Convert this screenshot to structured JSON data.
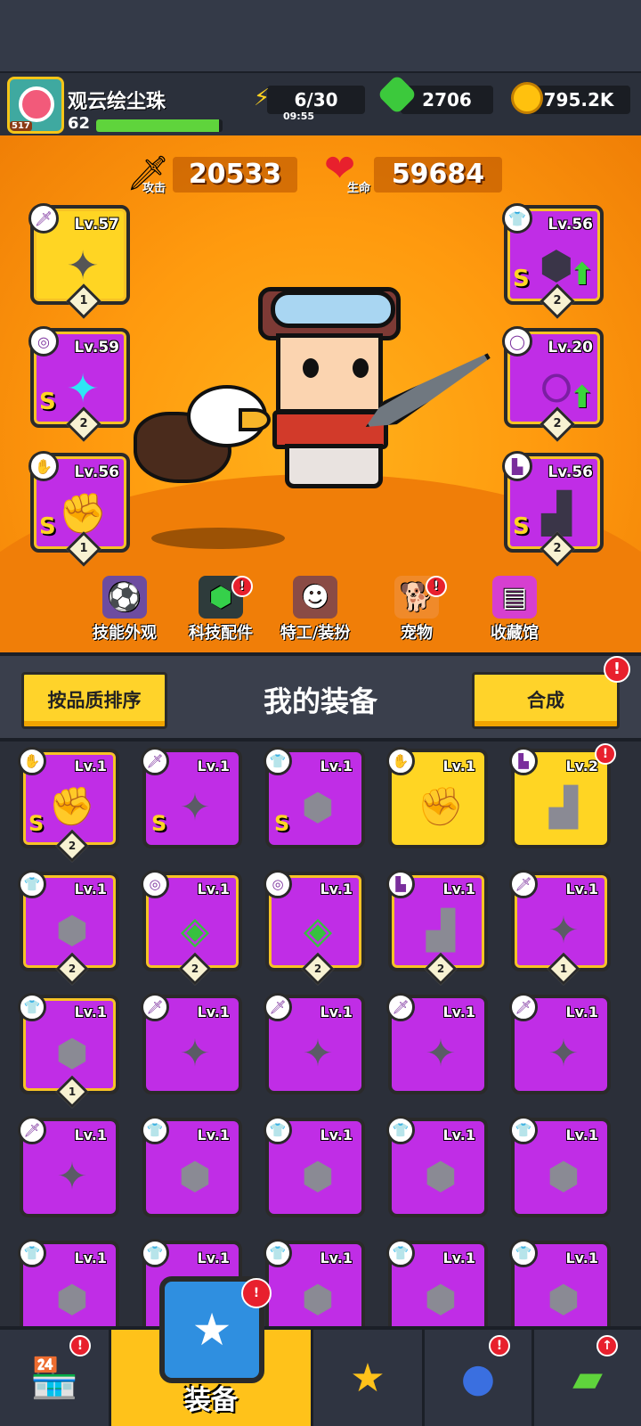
{
  "player": {
    "name": "观云绘尘珠",
    "level": "62",
    "badge": "517",
    "xp_fraction": 0.97
  },
  "resources": {
    "energy": {
      "value": "6/30",
      "timer": "09:55"
    },
    "gems": {
      "value": "2706"
    },
    "coins": {
      "value": "795.2K"
    }
  },
  "stats": {
    "attack": {
      "label": "攻击",
      "value": "20533"
    },
    "hp": {
      "label": "生命",
      "value": "59684"
    }
  },
  "equipped": [
    {
      "slot": "weapon",
      "level": "Lv.57",
      "star": "1",
      "rank": ""
    },
    {
      "slot": "necklace",
      "level": "Lv.59",
      "star": "2",
      "rank": "S"
    },
    {
      "slot": "glove",
      "level": "Lv.56",
      "star": "1",
      "rank": "S"
    },
    {
      "slot": "armor",
      "level": "Lv.56",
      "star": "2",
      "rank": "S"
    },
    {
      "slot": "belt",
      "level": "Lv.20",
      "star": "2",
      "rank": ""
    },
    {
      "slot": "boots",
      "level": "Lv.56",
      "star": "2",
      "rank": "S"
    }
  ],
  "menu": [
    {
      "label": "技能外观",
      "icon": "skill-skin-icon",
      "alert": false
    },
    {
      "label": "科技配件",
      "icon": "tech-parts-icon",
      "alert": true
    },
    {
      "label": "特工/装扮",
      "icon": "agent-icon",
      "alert": false
    },
    {
      "label": "宠物",
      "icon": "pet-icon",
      "alert": true
    },
    {
      "label": "收藏馆",
      "icon": "collection-icon",
      "alert": false
    }
  ],
  "inventory_header": {
    "sort_label": "按品质排序",
    "title": "我的装备",
    "merge_label": "合成",
    "merge_alert": "!"
  },
  "inventory": [
    {
      "level": "Lv.1",
      "slot": "glove",
      "rank": "S",
      "star": "2",
      "yellow": false
    },
    {
      "level": "Lv.1",
      "slot": "weapon",
      "rank": "S",
      "star": "",
      "yellow": false
    },
    {
      "level": "Lv.1",
      "slot": "armor",
      "rank": "S",
      "star": "",
      "yellow": false
    },
    {
      "level": "Lv.1",
      "slot": "glove",
      "rank": "",
      "star": "",
      "yellow": true
    },
    {
      "level": "Lv.2",
      "slot": "boots",
      "rank": "",
      "star": "",
      "yellow": true
    },
    {
      "level": "Lv.1",
      "slot": "armor",
      "rank": "",
      "star": "2",
      "yellow": false
    },
    {
      "level": "Lv.1",
      "slot": "necklace",
      "rank": "",
      "star": "2",
      "yellow": false
    },
    {
      "level": "Lv.1",
      "slot": "necklace",
      "rank": "",
      "star": "2",
      "yellow": false
    },
    {
      "level": "Lv.1",
      "slot": "boots",
      "rank": "",
      "star": "2",
      "yellow": false
    },
    {
      "level": "Lv.1",
      "slot": "weapon",
      "rank": "",
      "star": "1",
      "yellow": false
    },
    {
      "level": "Lv.1",
      "slot": "armor",
      "rank": "",
      "star": "1",
      "yellow": false
    },
    {
      "level": "Lv.1",
      "slot": "weapon",
      "rank": "",
      "star": "",
      "yellow": false
    },
    {
      "level": "Lv.1",
      "slot": "weapon",
      "rank": "",
      "star": "",
      "yellow": false
    },
    {
      "level": "Lv.1",
      "slot": "weapon",
      "rank": "",
      "star": "",
      "yellow": false
    },
    {
      "level": "Lv.1",
      "slot": "weapon",
      "rank": "",
      "star": "",
      "yellow": false
    },
    {
      "level": "Lv.1",
      "slot": "weapon",
      "rank": "",
      "star": "",
      "yellow": false
    },
    {
      "level": "Lv.1",
      "slot": "armor",
      "rank": "",
      "star": "",
      "yellow": false
    },
    {
      "level": "Lv.1",
      "slot": "armor",
      "rank": "",
      "star": "",
      "yellow": false
    },
    {
      "level": "Lv.1",
      "slot": "armor",
      "rank": "",
      "star": "",
      "yellow": false
    },
    {
      "level": "Lv.1",
      "slot": "armor",
      "rank": "",
      "star": "",
      "yellow": false
    },
    {
      "level": "Lv.1",
      "slot": "armor",
      "rank": "",
      "star": "",
      "yellow": false
    },
    {
      "level": "Lv.1",
      "slot": "armor",
      "rank": "",
      "star": "",
      "yellow": false
    },
    {
      "level": "Lv.1",
      "slot": "armor",
      "rank": "",
      "star": "",
      "yellow": false
    },
    {
      "level": "Lv.1",
      "slot": "armor",
      "rank": "",
      "star": "",
      "yellow": false
    },
    {
      "level": "Lv.1",
      "slot": "armor",
      "rank": "",
      "star": "",
      "yellow": false
    }
  ],
  "bottom_tabs": [
    {
      "label": "",
      "icon": "shop-icon",
      "alert": true
    },
    {
      "label": "装备",
      "icon": "equipment-icon",
      "alert": true
    },
    {
      "label": "",
      "icon": "battle-star-icon",
      "alert": false
    },
    {
      "label": "",
      "icon": "gacha-ball-icon",
      "alert": true
    },
    {
      "label": "",
      "icon": "evolve-capsule-icon",
      "alert": true
    }
  ]
}
